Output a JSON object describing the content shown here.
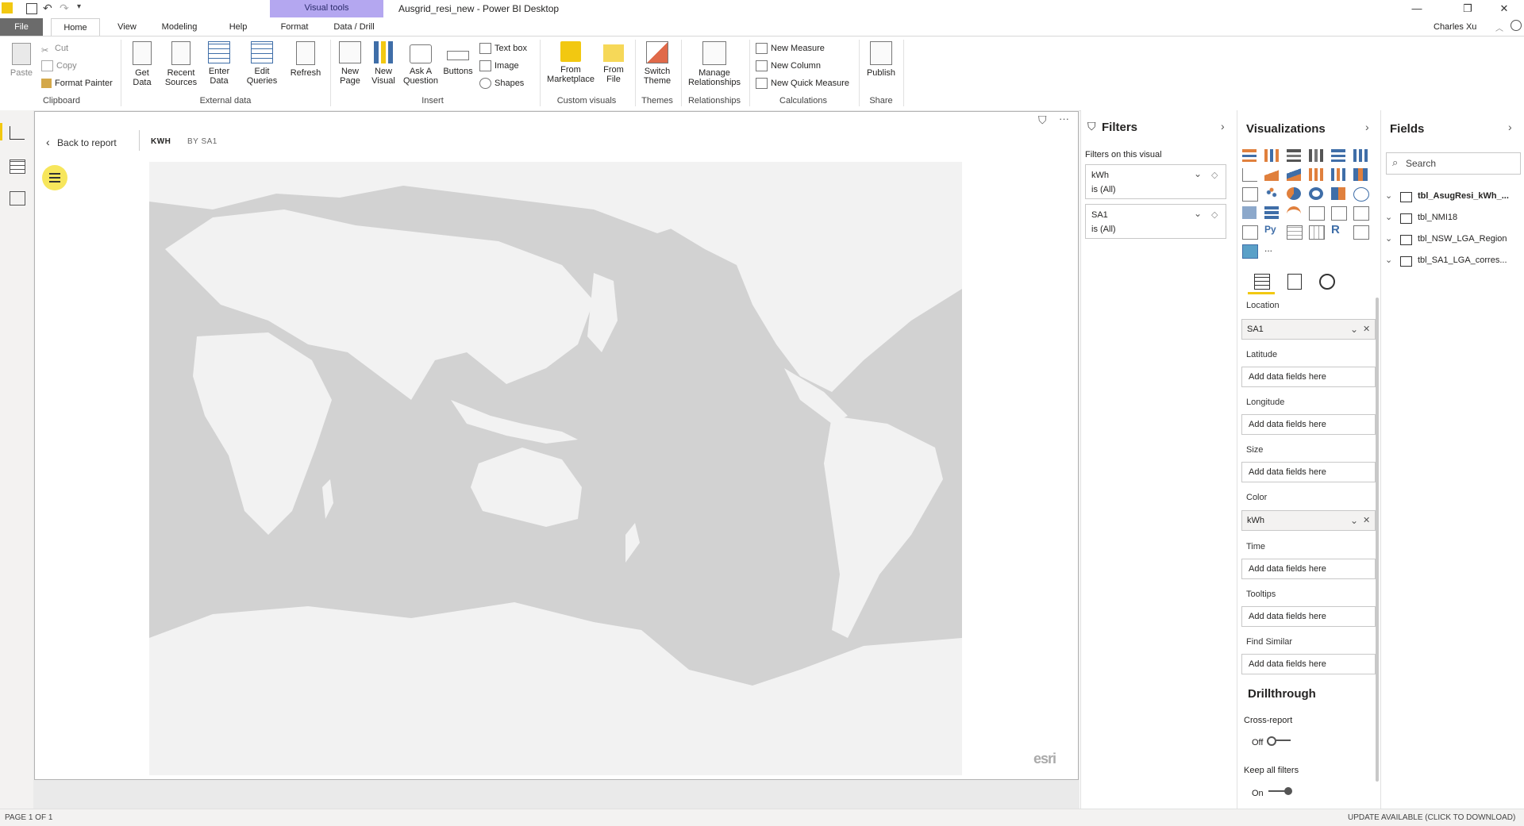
{
  "titlebar": {
    "context_tab": "Visual tools",
    "app_title": "Ausgrid_resi_new - Power BI Desktop",
    "user": "Charles Xu"
  },
  "tabs": [
    "File",
    "Home",
    "View",
    "Modeling",
    "Help",
    "Format",
    "Data / Drill"
  ],
  "ribbon": {
    "clipboard": {
      "paste": "Paste",
      "cut": "Cut",
      "copy": "Copy",
      "format_painter": "Format Painter",
      "label": "Clipboard"
    },
    "external_data": {
      "get_data": "Get Data",
      "recent_sources": "Recent Sources",
      "enter_data": "Enter Data",
      "edit_queries": "Edit Queries",
      "refresh": "Refresh",
      "label": "External data"
    },
    "insert": {
      "new_page": "New Page",
      "new_visual": "New Visual",
      "ask_question": "Ask A Question",
      "buttons": "Buttons",
      "text_box": "Text box",
      "image": "Image",
      "shapes": "Shapes",
      "label": "Insert"
    },
    "custom_visuals": {
      "from_marketplace": "From Marketplace",
      "from_file": "From File",
      "label": "Custom visuals"
    },
    "themes": {
      "switch_theme": "Switch Theme",
      "label": "Themes"
    },
    "relationships": {
      "manage": "Manage Relationships",
      "label": "Relationships"
    },
    "calculations": {
      "new_measure": "New Measure",
      "new_column": "New Column",
      "new_quick_measure": "New Quick Measure",
      "label": "Calculations"
    },
    "share": {
      "publish": "Publish",
      "label": "Share"
    }
  },
  "report": {
    "back": "Back to report",
    "crumb1": "KWH",
    "crumb2": "BY SA1",
    "esri": "esri"
  },
  "filters": {
    "title": "Filters",
    "subtitle": "Filters on this visual",
    "cards": [
      {
        "name": "kWh",
        "state": "is (All)"
      },
      {
        "name": "SA1",
        "state": "is (All)"
      }
    ]
  },
  "visualizations": {
    "title": "Visualizations",
    "more": "...",
    "wells": [
      {
        "label": "Location",
        "value": "SA1",
        "filled": true
      },
      {
        "label": "Latitude",
        "value": "Add data fields here",
        "filled": false
      },
      {
        "label": "Longitude",
        "value": "Add data fields here",
        "filled": false
      },
      {
        "label": "Size",
        "value": "Add data fields here",
        "filled": false
      },
      {
        "label": "Color",
        "value": "kWh",
        "filled": true
      },
      {
        "label": "Time",
        "value": "Add data fields here",
        "filled": false
      },
      {
        "label": "Tooltips",
        "value": "Add data fields here",
        "filled": false
      },
      {
        "label": "Find Similar",
        "value": "Add data fields here",
        "filled": false
      }
    ],
    "drillthrough": "Drillthrough",
    "cross_report": "Cross-report",
    "cross_state": "Off",
    "keep_filters": "Keep all filters",
    "keep_state": "On"
  },
  "fields": {
    "title": "Fields",
    "search_placeholder": "Search",
    "tables": [
      "tbl_AsugResi_kWh_...",
      "tbl_NMI18",
      "tbl_NSW_LGA_Region",
      "tbl_SA1_LGA_corres..."
    ]
  },
  "status": {
    "page": "PAGE 1 OF 1",
    "update": "UPDATE AVAILABLE (CLICK TO DOWNLOAD)"
  },
  "colors": {
    "accent": "#f2c811",
    "ctx_tab": "#b4a7f0",
    "file_tab": "#6b6b6b",
    "map_ocean": "#d2d2d2",
    "map_land": "#f2f2f2"
  }
}
